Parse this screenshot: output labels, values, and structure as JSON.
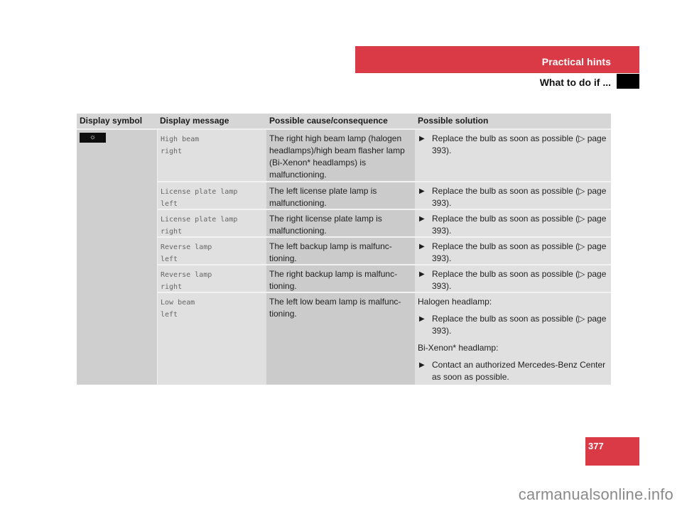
{
  "header": {
    "section_title": "Practical hints",
    "subtitle": "What to do if ...",
    "accent_color": "#d93a45"
  },
  "table": {
    "columns": [
      "Display symbol",
      "Display message",
      "Possible cause/consequence",
      "Possible solution"
    ],
    "symbol_icon": "high-beam-lamp-icon",
    "symbol_glyph": "☼",
    "rows": [
      {
        "message": [
          "High beam",
          "right"
        ],
        "cause": "The right high beam lamp (halogen headlamps)/high beam flasher lamp (Bi-Xenon* headlamps) is malfunctioning.",
        "solution": [
          {
            "type": "bullet",
            "text": "Replace the bulb as soon as possible (▷ page 393)."
          }
        ]
      },
      {
        "message": [
          "License plate lamp",
          "left"
        ],
        "cause": "The left license plate lamp is malfunctioning.",
        "solution": [
          {
            "type": "bullet",
            "text": "Replace the bulb as soon as possible (▷ page 393)."
          }
        ]
      },
      {
        "message": [
          "License plate lamp",
          "right"
        ],
        "cause": "The right license plate lamp is malfunctioning.",
        "solution": [
          {
            "type": "bullet",
            "text": "Replace the bulb as soon as possible (▷ page 393)."
          }
        ]
      },
      {
        "message": [
          "Reverse lamp",
          "left"
        ],
        "cause": "The left backup lamp is malfunc-tioning.",
        "solution": [
          {
            "type": "bullet",
            "text": "Replace the bulb as soon as possible (▷ page 393)."
          }
        ]
      },
      {
        "message": [
          "Reverse lamp",
          "right"
        ],
        "cause": "The right backup lamp is malfunc-tioning.",
        "solution": [
          {
            "type": "bullet",
            "text": "Replace the bulb as soon as possible (▷ page 393)."
          }
        ]
      },
      {
        "message": [
          "Low beam",
          "left"
        ],
        "cause": "The left low beam lamp is malfunc-tioning.",
        "solution": [
          {
            "type": "para",
            "text": "Halogen headlamp:"
          },
          {
            "type": "bullet",
            "text": "Replace the bulb as soon as possible (▷ page 393)."
          },
          {
            "type": "para",
            "text": "Bi-Xenon* headlamp:"
          },
          {
            "type": "bullet",
            "text": "Contact an authorized Mercedes-Benz Center as soon as possible."
          }
        ]
      }
    ]
  },
  "footer": {
    "page_number": "377",
    "watermark": "carmanualsonline.info"
  }
}
